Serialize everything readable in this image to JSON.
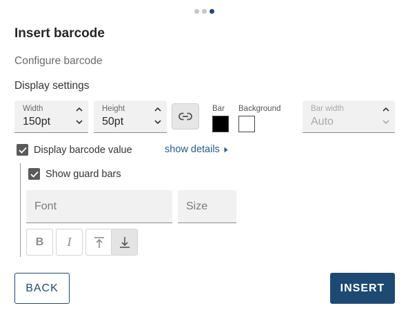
{
  "stepper": {
    "total": 3,
    "current": 3
  },
  "dialog": {
    "title": "Insert barcode",
    "subtitle": "Configure barcode",
    "section_title": "Display settings"
  },
  "width": {
    "label": "Width",
    "value": "150pt"
  },
  "height": {
    "label": "Height",
    "value": "50pt"
  },
  "link_icon": "link-icon",
  "colors": {
    "bar_label": "Bar",
    "bar_color": "#000000",
    "background_label": "Background",
    "background_color": "#ffffff"
  },
  "bar_width": {
    "label": "Bar width",
    "value": "Auto",
    "disabled": true
  },
  "display_value": {
    "label": "Display barcode value",
    "checked": true
  },
  "show_details": {
    "label": "show details"
  },
  "guard_bars": {
    "label": "Show guard bars",
    "checked": true
  },
  "font": {
    "placeholder": "Font"
  },
  "size": {
    "placeholder": "Size"
  },
  "format": {
    "bold": "B",
    "italic": "I",
    "align_top_icon": "align-top-icon",
    "align_bottom_icon": "align-bottom-icon",
    "active": "align-bottom"
  },
  "actions": {
    "back": "BACK",
    "insert": "INSERT"
  },
  "accent_color": "#1d4a73"
}
